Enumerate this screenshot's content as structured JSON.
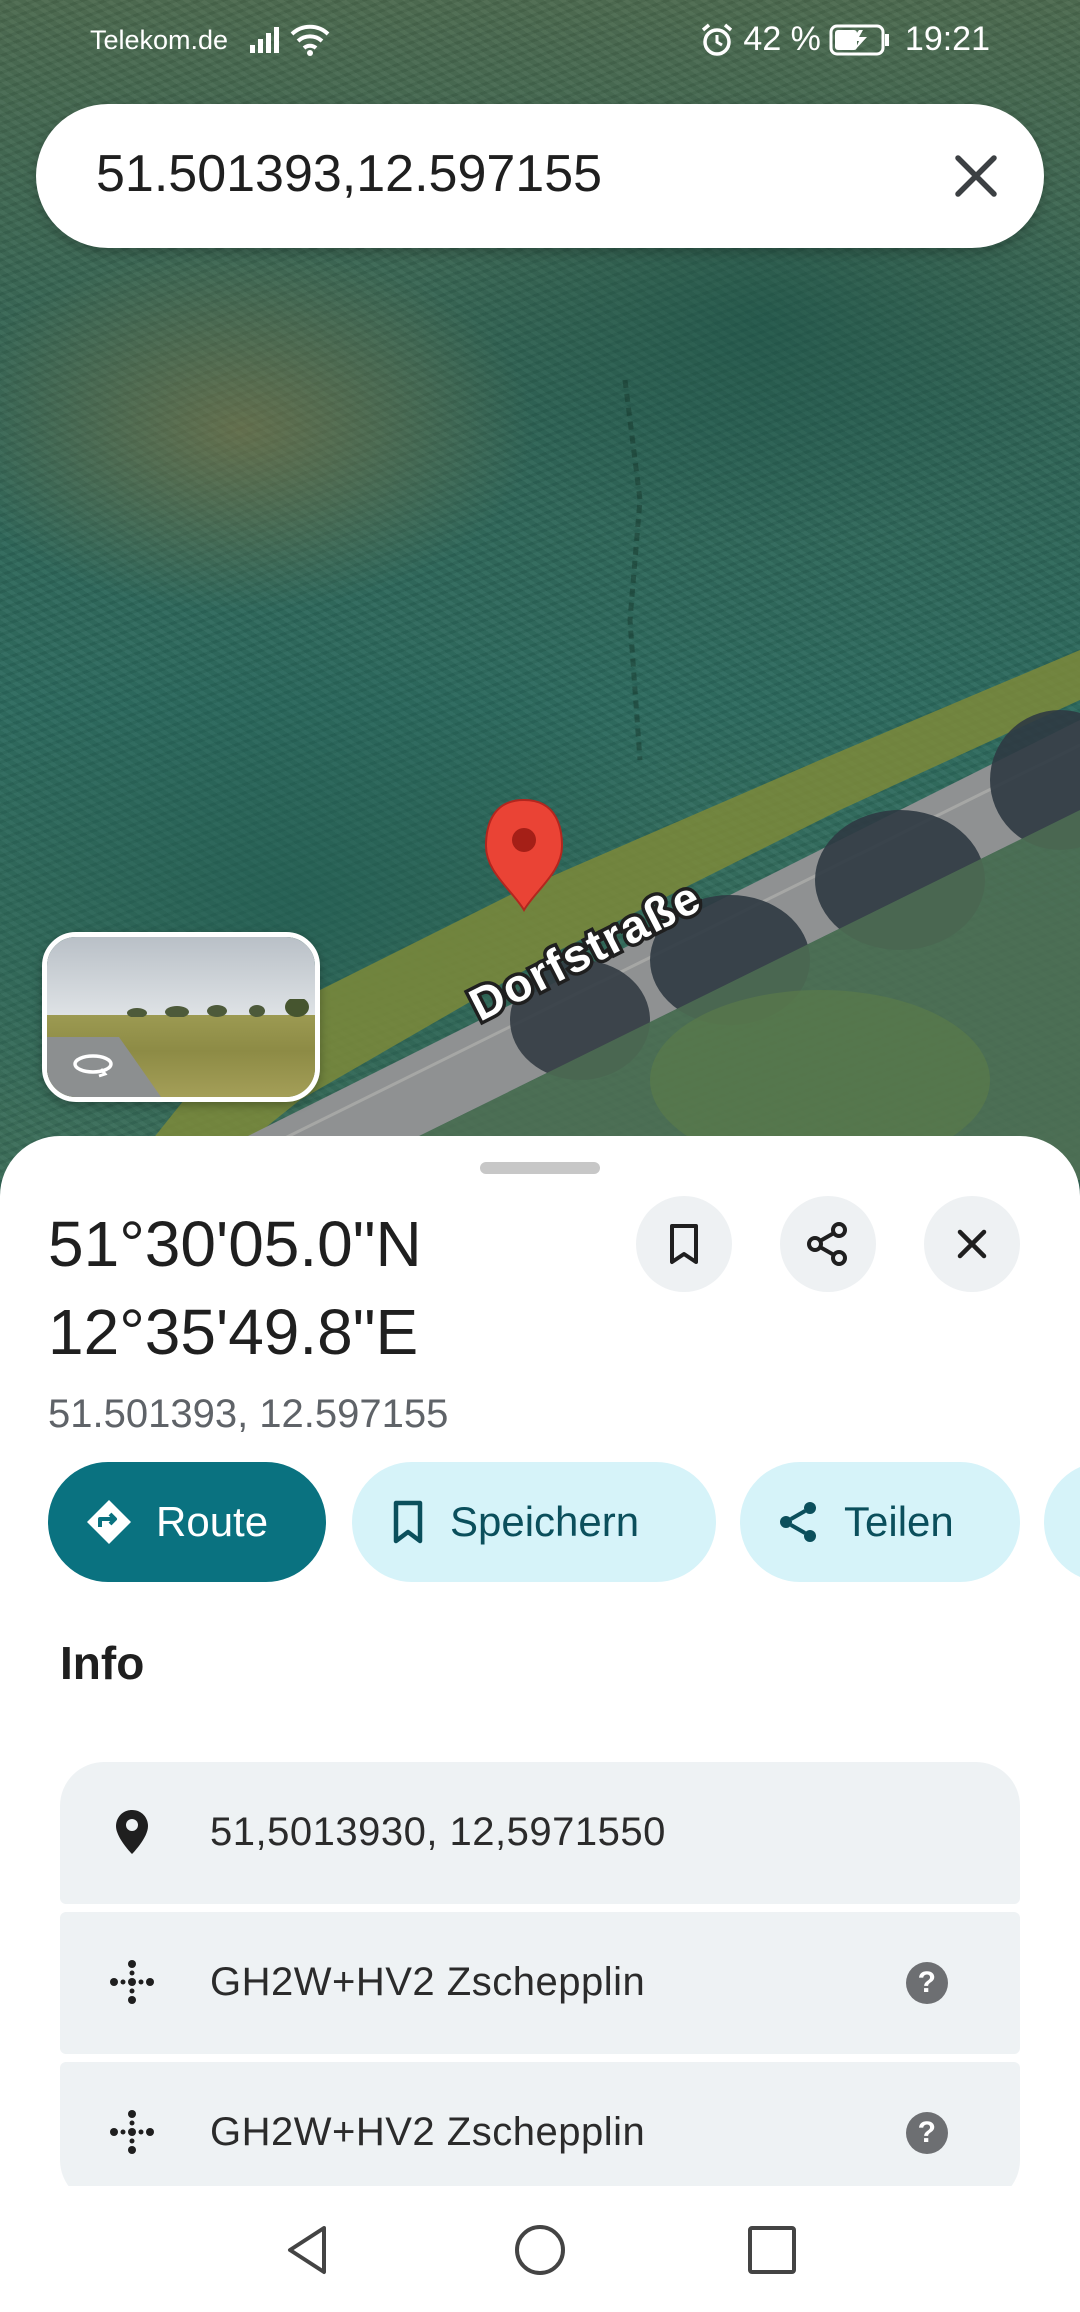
{
  "status_bar": {
    "carrier": "Telekom.de",
    "battery_percent": "42 %",
    "time": "19:21"
  },
  "search": {
    "query": "51.501393,12.597155"
  },
  "map": {
    "street_label": "Dorfstraße",
    "pin_color": "#ea4335"
  },
  "place": {
    "title_line1": "51°30'05.0\"N",
    "title_line2": "12°35'49.8\"E",
    "coordinates": "51.501393, 12.597155"
  },
  "actions": [
    {
      "label": "Route",
      "icon": "directions-icon"
    },
    {
      "label": "Speichern",
      "icon": "bookmark-icon"
    },
    {
      "label": "Teilen",
      "icon": "share-icon"
    }
  ],
  "info": {
    "heading": "Info",
    "rows": [
      {
        "text": "51,5013930, 12,5971550",
        "icon": "location-pin-icon"
      },
      {
        "text": "GH2W+HV2 Zschepplin",
        "icon": "plus-code-icon",
        "help": "?"
      },
      {
        "text": "GH2W+HV2 Zschepplin",
        "icon": "plus-code-icon",
        "help": "?"
      }
    ]
  },
  "colors": {
    "primary": "#0a7280",
    "chip_bg": "#d6f3f9",
    "chip_text": "#0b4f5c"
  }
}
